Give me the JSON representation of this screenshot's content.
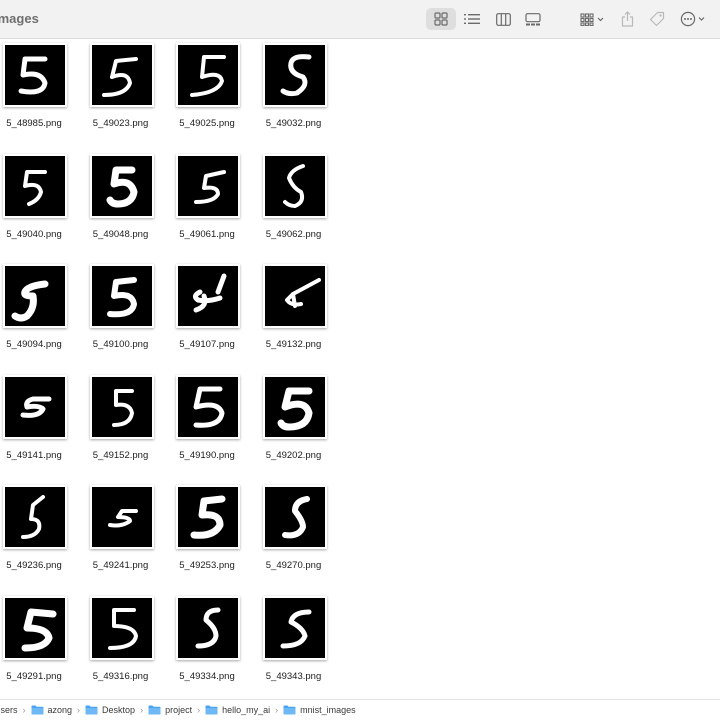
{
  "window": {
    "title": "images"
  },
  "toolbar": {
    "view_buttons": [
      {
        "name": "icon-view-button",
        "icon": "grid-icon",
        "active": true
      },
      {
        "name": "list-view-button",
        "icon": "list-icon",
        "active": false
      },
      {
        "name": "column-view-button",
        "icon": "columns-icon",
        "active": false
      },
      {
        "name": "gallery-view-button",
        "icon": "gallery-icon",
        "active": false
      }
    ],
    "action_buttons": [
      {
        "name": "group-button",
        "icon": "group-icon"
      },
      {
        "name": "share-button",
        "icon": "share-icon"
      },
      {
        "name": "tag-button",
        "icon": "tag-icon"
      },
      {
        "name": "more-button",
        "icon": "ellipsis-icon"
      }
    ]
  },
  "files": [
    {
      "name": "5_48985.png",
      "digit_variant": 0
    },
    {
      "name": "5_49023.png",
      "digit_variant": 1
    },
    {
      "name": "5_49025.png",
      "digit_variant": 2
    },
    {
      "name": "5_49032.png",
      "digit_variant": 3
    },
    {
      "name": "5_49040.png",
      "digit_variant": 4
    },
    {
      "name": "5_49048.png",
      "digit_variant": 5
    },
    {
      "name": "5_49061.png",
      "digit_variant": 6
    },
    {
      "name": "5_49062.png",
      "digit_variant": 7
    },
    {
      "name": "5_49094.png",
      "digit_variant": 8
    },
    {
      "name": "5_49100.png",
      "digit_variant": 9
    },
    {
      "name": "5_49107.png",
      "digit_variant": 10
    },
    {
      "name": "5_49132.png",
      "digit_variant": 11
    },
    {
      "name": "5_49141.png",
      "digit_variant": 12
    },
    {
      "name": "5_49152.png",
      "digit_variant": 13
    },
    {
      "name": "5_49190.png",
      "digit_variant": 14
    },
    {
      "name": "5_49202.png",
      "digit_variant": 15
    },
    {
      "name": "5_49236.png",
      "digit_variant": 16
    },
    {
      "name": "5_49241.png",
      "digit_variant": 17
    },
    {
      "name": "5_49253.png",
      "digit_variant": 18
    },
    {
      "name": "5_49270.png",
      "digit_variant": 19
    },
    {
      "name": "5_49291.png",
      "digit_variant": 20
    },
    {
      "name": "5_49316.png",
      "digit_variant": 21
    },
    {
      "name": "5_49334.png",
      "digit_variant": 22
    },
    {
      "name": "5_49343.png",
      "digit_variant": 23
    }
  ],
  "pathbar": {
    "crumbs": [
      {
        "label": "Users",
        "icon": ""
      },
      {
        "label": "azong",
        "icon": "folder-icon"
      },
      {
        "label": "Desktop",
        "icon": "folder-icon"
      },
      {
        "label": "project",
        "icon": "folder-icon"
      },
      {
        "label": "hello_my_ai",
        "icon": "folder-icon"
      },
      {
        "label": "mnist_images",
        "icon": "folder-icon"
      }
    ]
  },
  "colors": {
    "toolbar_bg": "#f2f2f2",
    "folder_blue": "#4aa3f0",
    "thumbnail_bg": "#000000",
    "digit_stroke": "#ffffff"
  }
}
